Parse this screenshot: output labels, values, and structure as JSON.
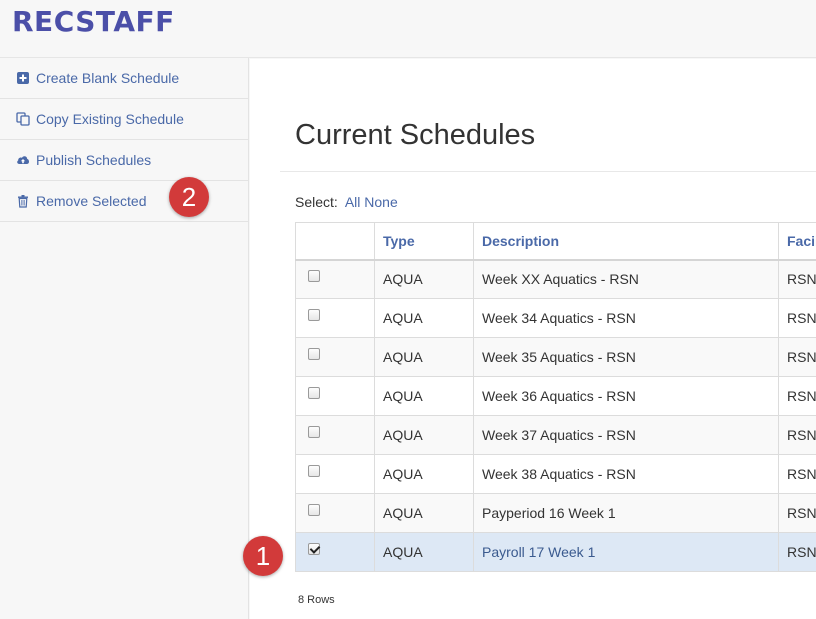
{
  "app": {
    "logo": "RECSTAFF"
  },
  "sidebar": {
    "items": [
      {
        "label": "Create Blank Schedule",
        "icon": "plus-square-icon"
      },
      {
        "label": "Copy Existing Schedule",
        "icon": "copy-icon"
      },
      {
        "label": "Publish Schedules",
        "icon": "cloud-upload-icon"
      },
      {
        "label": "Remove Selected",
        "icon": "trash-icon"
      }
    ]
  },
  "main": {
    "title": "Current Schedules",
    "select": {
      "label": "Select:",
      "all": "All",
      "none": "None"
    },
    "table": {
      "columns": [
        "",
        "Type",
        "Description",
        "Facil"
      ],
      "rows": [
        {
          "checked": false,
          "type": "AQUA",
          "description": "Week XX Aquatics - RSN",
          "facility": "RSN"
        },
        {
          "checked": false,
          "type": "AQUA",
          "description": "Week 34 Aquatics - RSN",
          "facility": "RSN"
        },
        {
          "checked": false,
          "type": "AQUA",
          "description": "Week 35 Aquatics - RSN",
          "facility": "RSN"
        },
        {
          "checked": false,
          "type": "AQUA",
          "description": "Week 36 Aquatics - RSN",
          "facility": "RSN"
        },
        {
          "checked": false,
          "type": "AQUA",
          "description": "Week 37 Aquatics - RSN",
          "facility": "RSN"
        },
        {
          "checked": false,
          "type": "AQUA",
          "description": "Week 38 Aquatics - RSN",
          "facility": "RSN"
        },
        {
          "checked": false,
          "type": "AQUA",
          "description": "Payperiod 16 Week 1",
          "facility": "RSN"
        },
        {
          "checked": true,
          "type": "AQUA",
          "description": "Payroll 17 Week 1",
          "facility": "RSN"
        }
      ]
    },
    "row_count": "8 Rows"
  },
  "annotations": {
    "step1": "1",
    "step2": "2"
  },
  "colors": {
    "brand": "#4b4fa8",
    "link": "#4a69a8",
    "badge": "#d23a3a",
    "selected_row": "#dde8f5"
  }
}
